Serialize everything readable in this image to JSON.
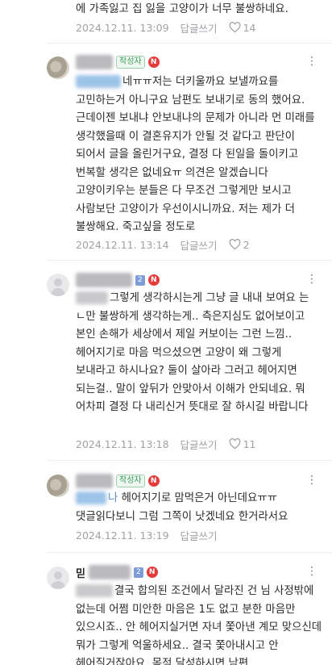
{
  "comments": [
    {
      "text": "에 가족잃고 집 잃을 고양이가 너무 불쌍하네요.",
      "date": "2024.12.11. 13:09",
      "reply": "답글쓰기",
      "likes": "14"
    },
    {
      "author_badge": "작성자",
      "new_badge": "N",
      "text": "네ㅠㅠ저는 더키울까요 보낼까요를 고민하는거 아니구요 남편도 보내기로 동의 했어요. 근데이젠 보내냐 안보내냐의 문제가 아니라 먼 미래를 생각했을때 이 결혼유지가 안될 것 같다고 판단이 되어서 글을 올린거구요, 결정 다 된일을 돌이키고 번복할 생각은 없네요ㅠ 의견은 알겠습니다 고양이키우는 분들은 다 무조건 그렇게만 보시고 사람보단 고양이가 우선이시니까요. 저는 제가 더 불쌍해요. 죽고싶을 정도로",
      "date": "2024.12.11. 13:14",
      "reply": "답글쓰기",
      "likes": "2"
    },
    {
      "level_badge": "2",
      "new_badge": "N",
      "text": "그렇게 생각하시는게 그냥 글 내내 보여요 는 ㄴ만 불쌍하게 생각하는게.. 측은지심도 없어보이고 본인 손해가 세상에서 제일 커보이는 그런 느낌.. 헤어지기로 마음 먹으셨으면 고양이 왜 그렇게 보내라고 하시나요? 둘이 살아라 그러고 헤어지면 되는걸.. 말이 앞뒤가 안맞아서 이해가 안되네요. 뭐 어차피 결정 다 내리신거 뜻대로 잘 하시길 바랍니다",
      "date": "2024.12.11. 13:18",
      "reply": "답글쓰기",
      "likes": "11"
    },
    {
      "author_badge": "작성자",
      "new_badge": "N",
      "name_fragment": "나",
      "text": "헤어지기로 맘먹은거 아닌데요ㅠㅠ 댓글읽다보니 그럼 그쪽이 낫겠네요 한거라서요",
      "date": "2024.12.11. 13:19",
      "reply": "답글쓰기"
    },
    {
      "name_fragment": "믿",
      "level_badge": "2",
      "new_badge": "N",
      "text": "결국 합의된 조건에서 달라진 건 님 사정밖에 없는데 어쩜 미안한 마음은 1도 없고 분한 마음만 있으시죠.. 안 헤어지실거면 자녀 쫓아낸 계모 맞으신데 뭐가 그렇게 억울하세요.. 결국 쫓아내시고 안 헤어질거잖아요. 목적 달성하시면 남편"
    }
  ]
}
